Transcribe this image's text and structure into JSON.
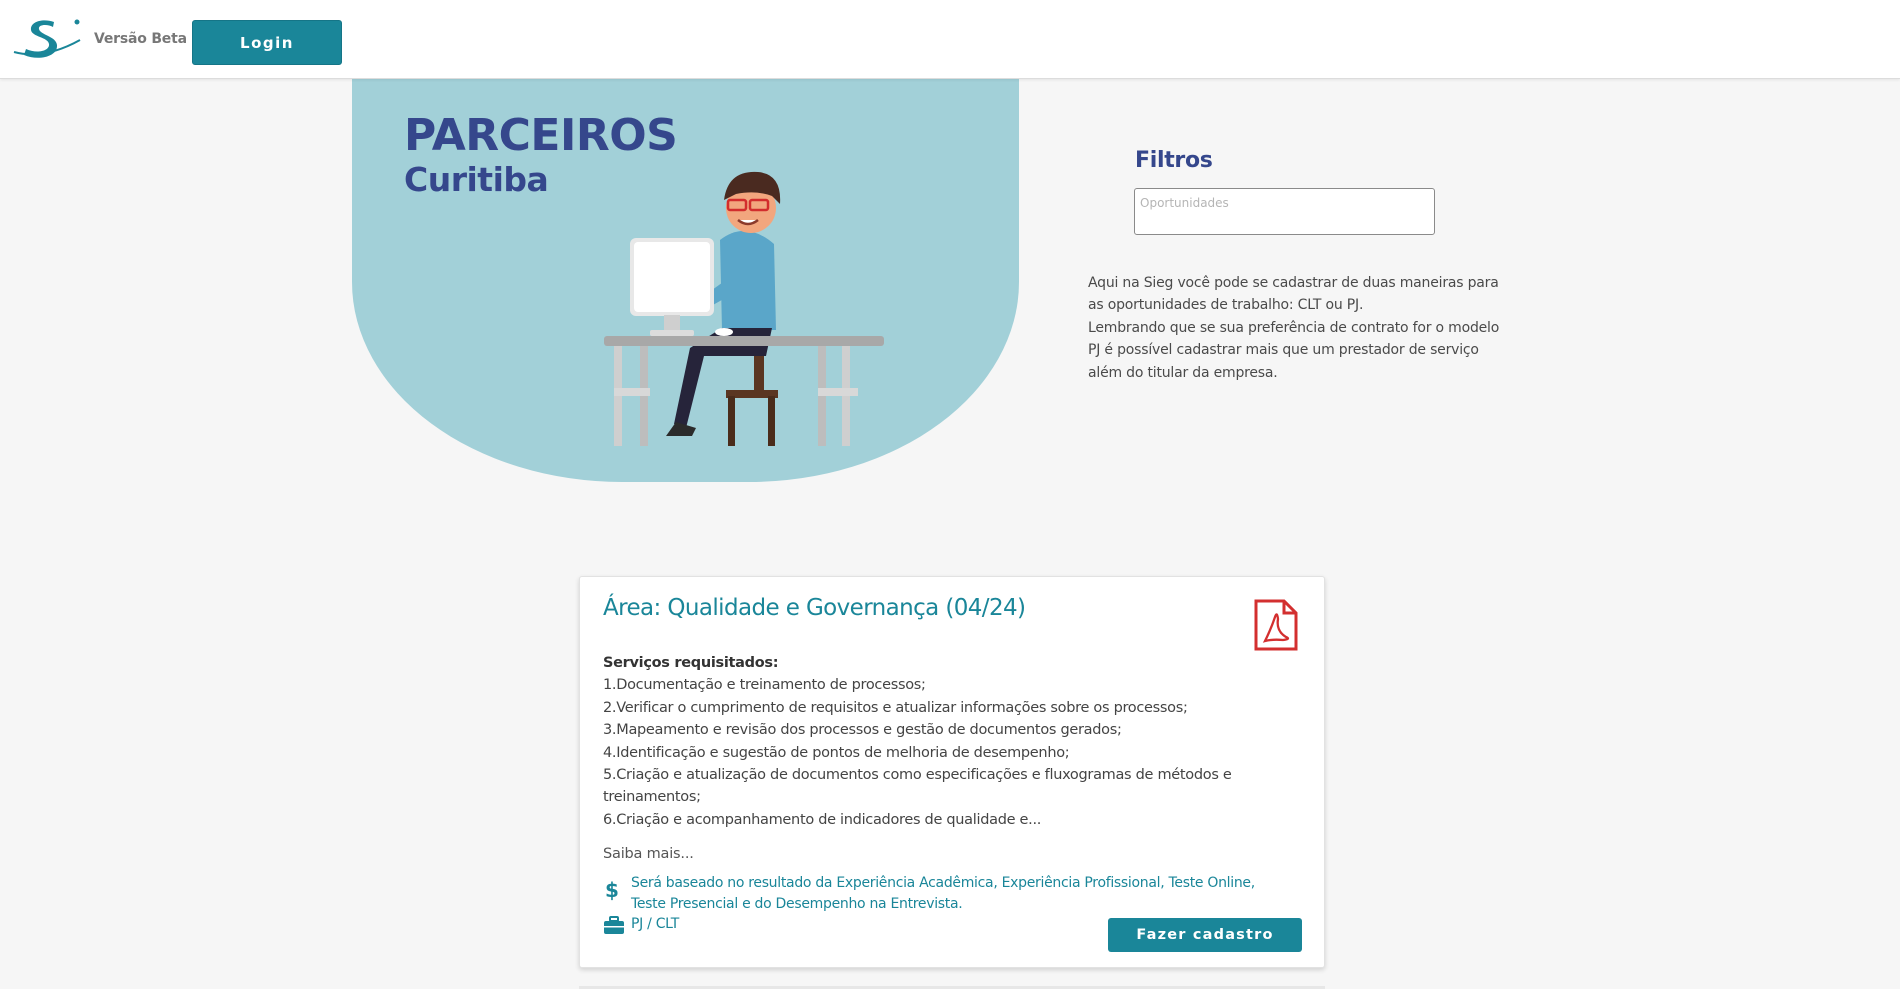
{
  "header": {
    "beta_label": "Versão Beta",
    "login_label": "Login"
  },
  "hero": {
    "title": "PARCEIROS",
    "subtitle": "Curitiba"
  },
  "filters": {
    "title": "Filtros",
    "input_placeholder": "Oportunidades",
    "input_value": ""
  },
  "info": {
    "line1": "Aqui na Sieg você pode se cadastrar de duas maneiras para as oportunidades de trabalho: CLT ou PJ.",
    "line2": "Lembrando que se sua preferência de contrato for o modelo PJ é possível cadastrar mais que um prestador de serviço além do titular da empresa."
  },
  "card": {
    "title": "Área: Qualidade e Governança (04/24)",
    "services_title": "Serviços requisitados:",
    "services": [
      "1.Documentação e treinamento de processos;",
      "2.Verificar o cumprimento de requisitos e atualizar informações sobre os processos;",
      "3.Mapeamento e revisão dos processos e gestão de documentos gerados;",
      "4.Identificação e sugestão de pontos de melhoria de desempenho;",
      "5.Criação e atualização de documentos como especificações e fluxogramas de métodos e treinamentos;",
      "6.Criação e acompanhamento de indicadores de qualidade e..."
    ],
    "more_label": "Saiba mais...",
    "salary_symbol": "$",
    "salary_text": "Será baseado no resultado da Experiência Acadêmica, Experiência Profissional, Teste Online, Teste Presencial e do Desempenho na Entrevista.",
    "contract_type": "PJ / CLT",
    "signup_label": "Fazer cadastro"
  },
  "colors": {
    "accent": "#1a8699",
    "brand_navy": "#35478c",
    "hero_bg": "#a2d0d8",
    "pdf_red": "#d32f2f"
  },
  "icons": [
    "sieg-logo",
    "person-at-computer-illustration",
    "pdf-icon",
    "dollar-icon",
    "briefcase-icon"
  ]
}
